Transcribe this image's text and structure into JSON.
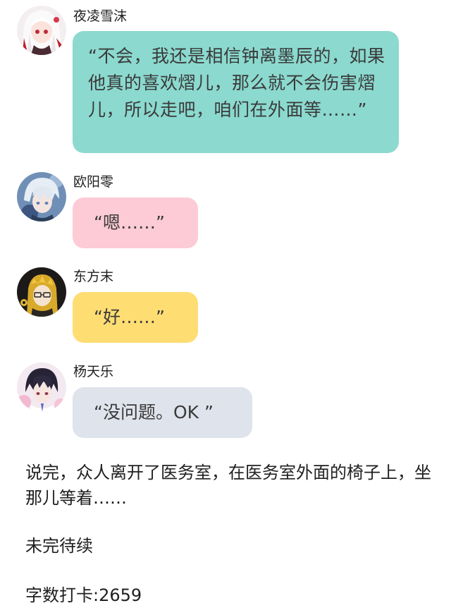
{
  "messages": [
    {
      "sender": "夜凌雪沫",
      "avatar_icon": "girl-white-hair-avatar-icon",
      "bubble_color": "#8bd9cf",
      "text": "“不会，我还是相信钟离墨辰的，如果他真的喜欢熠儿，那么就不会伤害熠儿，所以走吧，咱们在外面等……”"
    },
    {
      "sender": "欧阳零",
      "avatar_icon": "boy-silver-hair-avatar-icon",
      "bubble_color": "#fccbd5",
      "text": "“嗯……”"
    },
    {
      "sender": "东方末",
      "avatar_icon": "boy-glasses-yellow-hair-avatar-icon",
      "bubble_color": "#fedd73",
      "text": "“好……”"
    },
    {
      "sender": "杨天乐",
      "avatar_icon": "boy-dark-hair-avatar-icon",
      "bubble_color": "#dfe3ec",
      "text": "“没问题。OK ”"
    }
  ],
  "narration": "说完，众人离开了医务室，在医务室外面的椅子上，坐那儿等着……",
  "status": "未完待续",
  "word_count": "字数打卡:2659"
}
